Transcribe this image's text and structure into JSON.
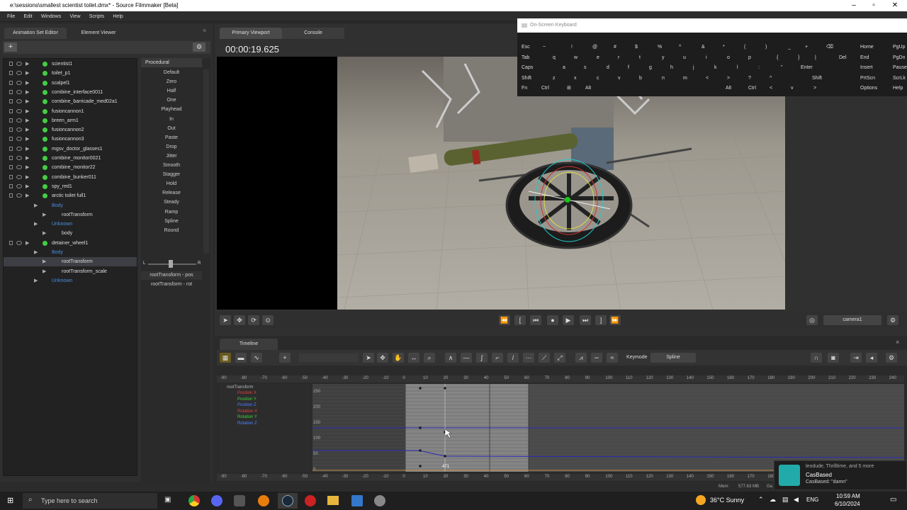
{
  "window": {
    "title": "e:\\sessions\\smallest scientist toilet.dmx* - Source Filmmaker [Beta]"
  },
  "menu": [
    "File",
    "Edit",
    "Windows",
    "View",
    "Scripts",
    "Help"
  ],
  "left_tabs": [
    "Animation Set Editor",
    "Element Viewer"
  ],
  "tree": [
    {
      "label": "scientist1",
      "indent": 0
    },
    {
      "label": "toilet_p1",
      "indent": 0
    },
    {
      "label": "scalpel1",
      "indent": 0
    },
    {
      "label": "combine_interface0011",
      "indent": 0
    },
    {
      "label": "combine_barricade_med02a1",
      "indent": 0
    },
    {
      "label": "fusioncannon1",
      "indent": 0
    },
    {
      "label": "breen_arm1",
      "indent": 0
    },
    {
      "label": "fusioncannon2",
      "indent": 0
    },
    {
      "label": "fusioncannon3",
      "indent": 0
    },
    {
      "label": "mgsv_doctor_glasses1",
      "indent": 0
    },
    {
      "label": "combine_monitor0021",
      "indent": 0
    },
    {
      "label": "combine_monitor22",
      "indent": 0
    },
    {
      "label": "combine_bunker011",
      "indent": 0
    },
    {
      "label": "spy_red1",
      "indent": 0
    },
    {
      "label": "arctic toilet full1",
      "indent": 0
    },
    {
      "label": "Body",
      "indent": 1
    },
    {
      "label": "rootTransform",
      "indent": 2
    },
    {
      "label": "Unknown",
      "indent": 1
    },
    {
      "label": "body",
      "indent": 2
    },
    {
      "label": "detainer_wheel1",
      "indent": 0
    },
    {
      "label": "Body",
      "indent": 1
    },
    {
      "label": "rootTransform",
      "indent": 2
    },
    {
      "label": "rootTransform_scale",
      "indent": 2
    },
    {
      "label": "Unknown",
      "indent": 1
    }
  ],
  "procedural": {
    "header": "Procedural",
    "items": [
      "Default",
      "Zero",
      "Half",
      "One",
      "Playhead",
      "In",
      "Out",
      "Paste",
      "Drop",
      "Jitter",
      "Smooth",
      "Stagger",
      "Hold",
      "Release",
      "Steady",
      "Ramp",
      "Spline",
      "Round"
    ],
    "slider_left": "L",
    "slider_right": "R",
    "extra": [
      "rootTransform - pos",
      "rootTransform - rot"
    ]
  },
  "viewport": {
    "tabs": [
      "Primary Viewport",
      "Console"
    ],
    "timecode": "00:00:19.625",
    "camera": "camera1"
  },
  "osk": {
    "title": "On-Screen Keyboard",
    "rows": [
      [
        "Esc",
        "~",
        "!",
        "@",
        "#",
        "$",
        "%",
        "^",
        "&",
        "*",
        "(",
        ")",
        "_",
        "+",
        "⌫"
      ],
      [
        "Tab",
        "q",
        "w",
        "e",
        "r",
        "t",
        "y",
        "u",
        "i",
        "o",
        "p",
        "{",
        "}",
        "|",
        "Del"
      ],
      [
        "Caps",
        "a",
        "s",
        "d",
        "f",
        "g",
        "h",
        "j",
        "k",
        "l",
        ":",
        "\"",
        "Enter"
      ],
      [
        "Shift",
        "z",
        "x",
        "c",
        "v",
        "b",
        "n",
        "m",
        "<",
        ">",
        "?",
        "^",
        "Shift"
      ],
      [
        "Fn",
        "Ctrl",
        "⊞",
        "Alt",
        "Alt",
        "Ctrl",
        "<",
        "v",
        ">"
      ]
    ],
    "right": [
      [
        "Home",
        "PgUp"
      ],
      [
        "End",
        "PgDn"
      ],
      [
        "Insert",
        "Pause"
      ],
      [
        "PrtScn",
        "ScrLk"
      ],
      [
        "Options",
        "Help"
      ]
    ]
  },
  "timeline": {
    "tab": "Timeline",
    "keymode_label": "Keymode",
    "keymode_value": "Spline",
    "root": "rootTransform",
    "channels": [
      {
        "name": "Position X",
        "color": "#e04040"
      },
      {
        "name": "Position Y",
        "color": "#40d040"
      },
      {
        "name": "Position Z",
        "color": "#5080ff"
      },
      {
        "name": "Rotation X",
        "color": "#e04040"
      },
      {
        "name": "Rotation Y",
        "color": "#40d040"
      },
      {
        "name": "Rotation Z",
        "color": "#5080ff"
      }
    ],
    "ruler": [
      "-90",
      "-80",
      "-70",
      "-60",
      "-50",
      "-40",
      "-30",
      "-20",
      "-10",
      "0",
      "10",
      "20",
      "30",
      "40",
      "50",
      "60",
      "70",
      "80",
      "90",
      "100",
      "110",
      "120",
      "130",
      "140",
      "150",
      "160",
      "170",
      "180",
      "190",
      "200",
      "210",
      "220",
      "230",
      "240"
    ],
    "yaxis": [
      "250",
      "200",
      "150",
      "100",
      "50",
      "0"
    ],
    "frame_value": "471"
  },
  "status": {
    "mem": "Mem:",
    "mem_value": "577.63 MB",
    "ga": "Ga"
  },
  "notification": {
    "title": "leodude, Thrilltime, and 5 more",
    "name": "CasBased",
    "message": "CasBased: \"damn\""
  },
  "taskbar": {
    "search": "Type here to search",
    "weather": "36°C  Sunny",
    "lang": "ENG",
    "time": "10:59 AM",
    "date": "6/10/2024"
  }
}
